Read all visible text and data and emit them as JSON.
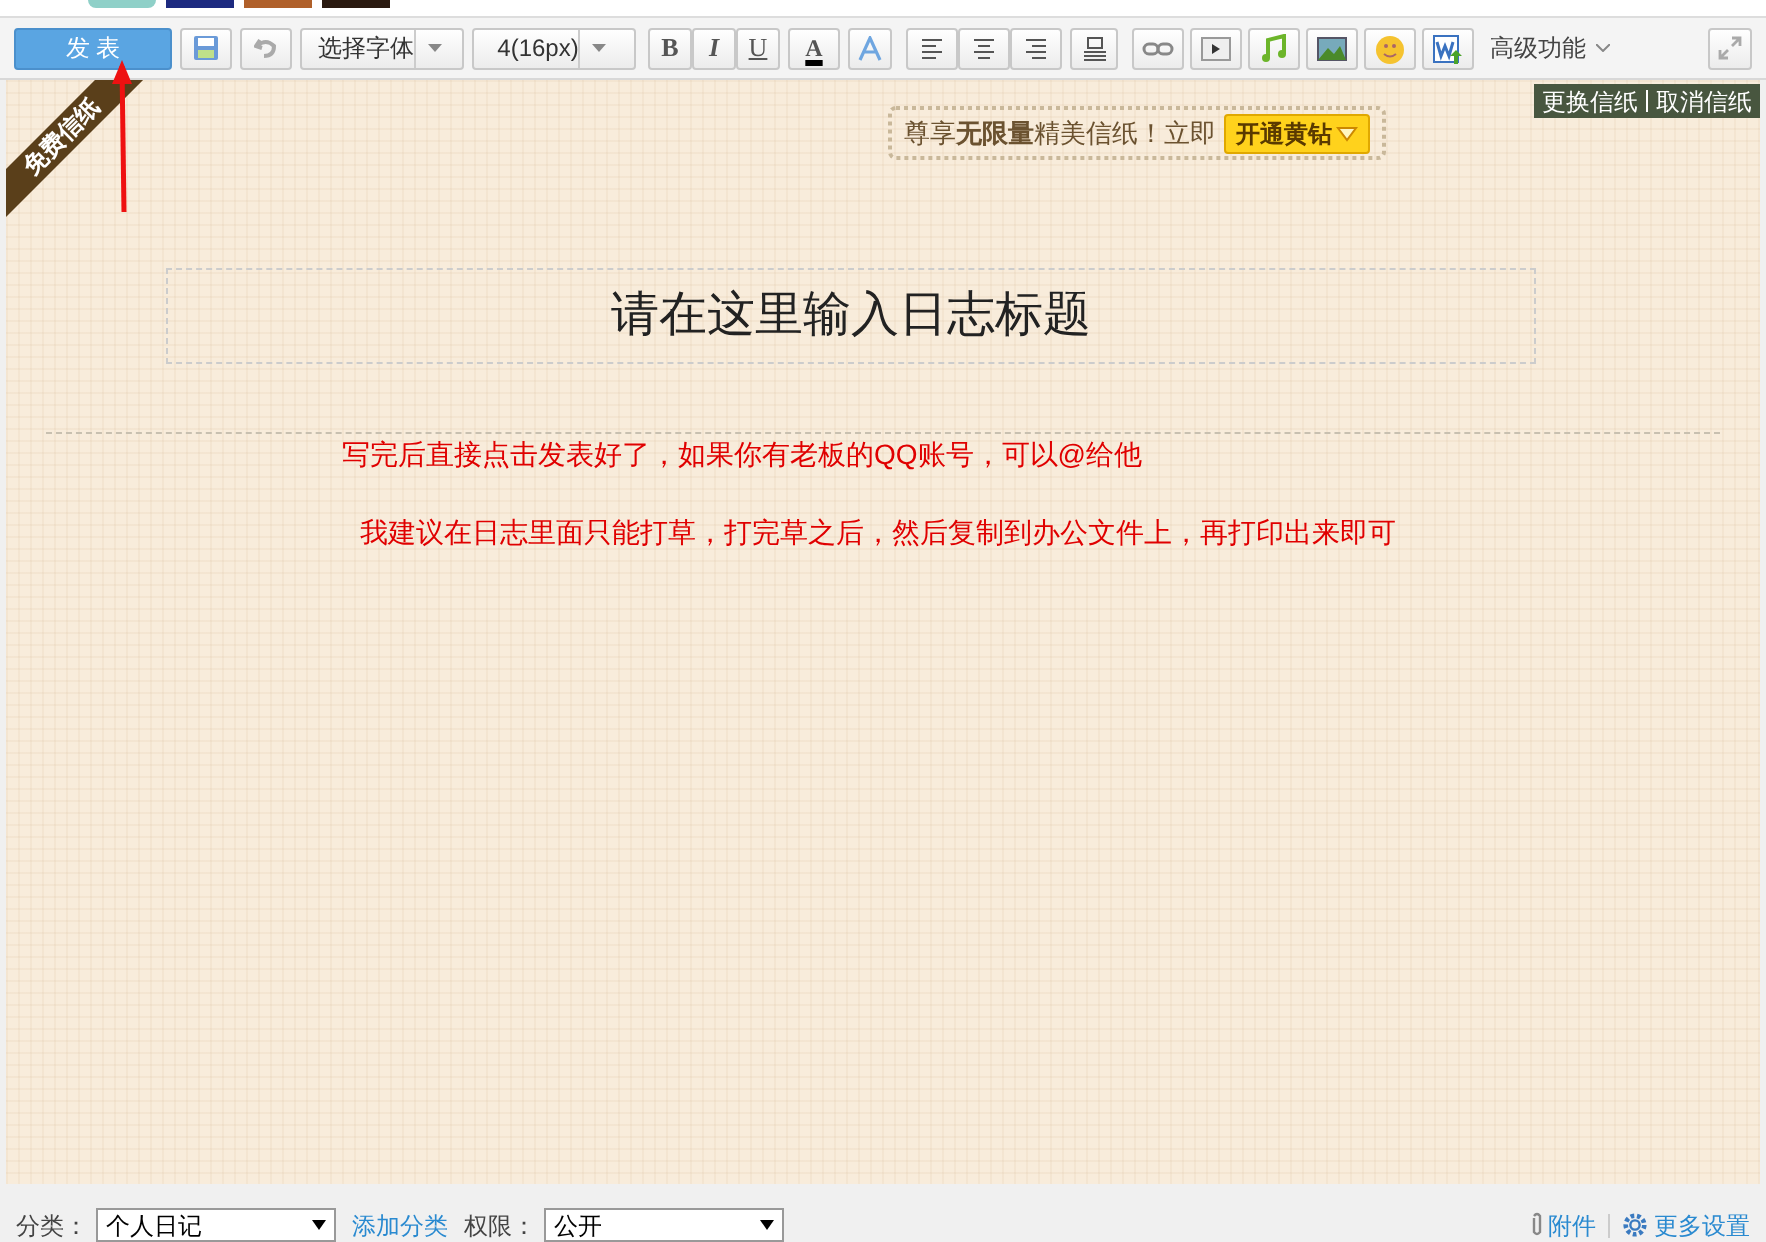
{
  "toolbar": {
    "publish_button": "发 表",
    "font_select": "选择字体",
    "size_select": "4(16px)",
    "bold": "B",
    "italic": "I",
    "underline": "U",
    "font_color": "A",
    "advanced": "高级功能"
  },
  "ribbon": "免费信纸",
  "promo": {
    "text": "尊享**无限量**精美信纸！立即",
    "button": "开通黄钻"
  },
  "stationery_links": [
    "更换信纸",
    "取消信纸"
  ],
  "title_placeholder": "请在这里输入日志标题",
  "body": [
    "写完后直接点击发表好了，如果你有老板的QQ账号，可以@给他",
    "我建议在日志里面只能打草，打完草之后，然后复制到办公文件上，再打印出来即可"
  ],
  "footer": {
    "category_label": "分类：",
    "category": "个人日记",
    "add_category": "添加分类",
    "permission_label": "权限：",
    "permission": "公开",
    "attachment": "附件",
    "more_settings": "更多设置"
  }
}
